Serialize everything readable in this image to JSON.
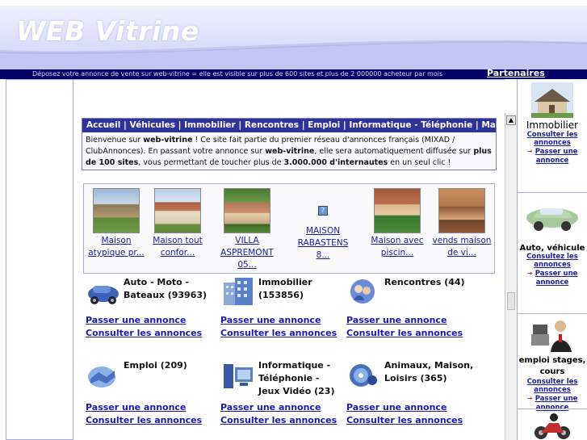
{
  "header": {
    "site_title": "WEB Vitrine",
    "tagline": "Déposez votre annonce de vente sur web-vitrine = elle est visible sur plus de 600 sites et plus de 2 000000 acheteur par mois",
    "partners_label": "Partenaires"
  },
  "nav": {
    "items": [
      "Accueil",
      "Véhicules",
      "Immobilier",
      "Rencontres",
      "Emploi",
      "Informatique - Téléphonie",
      "Maison & Loisirs"
    ]
  },
  "welcome": {
    "p1": "Bienvenue sur ",
    "b1": "web-vitrine",
    "p2": " ! Ce site fait partie du premier réseau d'annonces français (MIXAD / ClubAnnonces). En passant votre annonce sur ",
    "b2": "web-vitrine",
    "p3": ", elle sera automatiquement diffusée sur ",
    "b3": "plus de 100 sites",
    "p4": ", vous permettant de toucher plus de ",
    "b4": "3.000.000 d'internautes",
    "p5": " en un seul clic !"
  },
  "listings": [
    {
      "caption": "Maison atypique pr..."
    },
    {
      "caption": "Maison tout confor..."
    },
    {
      "caption": "VILLA ASPREMONT 05..."
    },
    {
      "caption": "MAISON RABASTENS 8..."
    },
    {
      "caption": "Maison avec piscin..."
    },
    {
      "caption": "vends maison de vi..."
    }
  ],
  "categories": [
    {
      "title": "Auto - Moto - Bateaux (93963)",
      "post": "Passer une annonce",
      "browse": "Consulter les annonces",
      "icon": "car-icon"
    },
    {
      "title": "Immobilier (153856)",
      "post": "Passer une annonce",
      "browse": "Consulter les annonces",
      "icon": "building-icon"
    },
    {
      "title": "Rencontres (44)",
      "post": "Passer une annonce",
      "browse": "Consulter les annonces",
      "icon": "couple-icon"
    },
    {
      "title": "Emploi (209)",
      "post": "Passer une annonce",
      "browse": "Consulter les annonces",
      "icon": "handshake-icon"
    },
    {
      "title": "Informatique - Téléphonie - Jeux Vidéo (23)",
      "post": "Passer une annonce",
      "browse": "Consulter les annonces",
      "icon": "computer-icon"
    },
    {
      "title": "Animaux, Maison, Loisirs (365)",
      "post": "Passer une annonce",
      "browse": "Consulter les annonces",
      "icon": "cd-icon"
    }
  ],
  "sidebar": [
    {
      "title": "Immobilier",
      "browse": "Consulter les annonces",
      "post": "Passer une annonce"
    },
    {
      "title": "Auto, véhicule",
      "browse": "Consultez les annonces",
      "post": "Passer une annonce"
    },
    {
      "title": "emploi stages, cours",
      "browse": "Consulter les annonces",
      "post": "Passer une annonce"
    }
  ],
  "colors": {
    "nav_bg": "#2e3399",
    "topbar_bg": "#000066",
    "link": "#1a1aa6",
    "header_bg": "#cfd2f7"
  }
}
